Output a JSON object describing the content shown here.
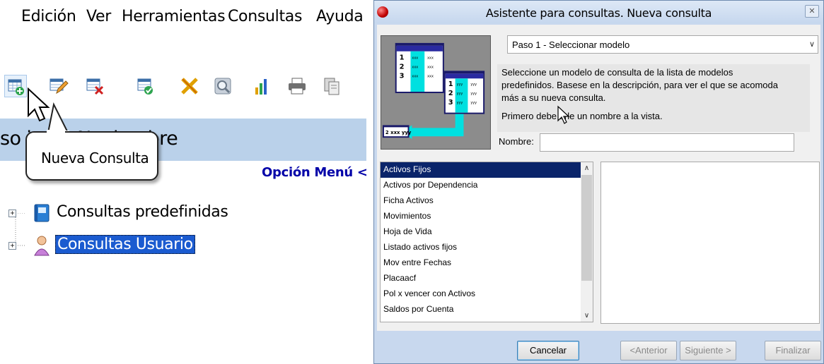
{
  "menubar": {
    "items": [
      "Edición",
      "Ver",
      "Herramientas",
      "Consultas",
      "Ayuda"
    ]
  },
  "toolbar": {
    "buttons": [
      "new-query-icon",
      "edit-query-icon",
      "delete-query-icon",
      "run-query-icon",
      "cut-icon",
      "search-icon",
      "chart-icon",
      "print-icon",
      "copy-icon"
    ]
  },
  "header": {
    "periodo": "so        iodo: Noviembre",
    "opcion_menu": "Opción Menú <<"
  },
  "tooltip": {
    "text": "Nueva Consulta"
  },
  "tree": {
    "items": [
      {
        "label": "Consultas predefinidas",
        "expander": "+",
        "selected": false
      },
      {
        "label": "Consultas Usuario",
        "expander": "+",
        "selected": true
      }
    ]
  },
  "dialog": {
    "title": "Asistente para consultas. Nueva consulta",
    "close": "✕",
    "step": "Paso 1 - Seleccionar modelo",
    "description_lines": [
      "Seleccione un modelo de consulta de la lista de modelos",
      "predefinidos. Basese en la descripción, para ver el que se acomoda",
      "más a su nueva consulta.",
      "Primero debe   arle un nombre a la vista."
    ],
    "nombre_label": "Nombre:",
    "nombre_value": "",
    "models": [
      "Activos Fijos",
      "Activos por Dependencia",
      "Ficha Activos",
      "Movimientos",
      "Hoja de Vida",
      "Listado  activos fijos",
      "Mov entre Fechas",
      "Placaacf",
      "Pol x vencer con Activos",
      "Saldos por Cuenta"
    ],
    "selected_model_index": 0,
    "buttons": {
      "cancelar": "Cancelar",
      "anterior": "<Anterior",
      "siguiente": "Siguiente >",
      "finalizar": "Finalizar"
    },
    "illustration": {
      "rows": [
        "1",
        "2",
        "3"
      ],
      "cell_text": "xxx",
      "yyy_text": "yyy",
      "result_text": "2 xxx yyy"
    }
  },
  "colors": {
    "selection_blue": "#0a246a",
    "tree_selection": "#1b5bd0",
    "header_band": "#bad1ea",
    "dialog_frame": "#c8d8ee",
    "menu_link": "#0000a8",
    "illus_cyan": "#00e0e0"
  }
}
